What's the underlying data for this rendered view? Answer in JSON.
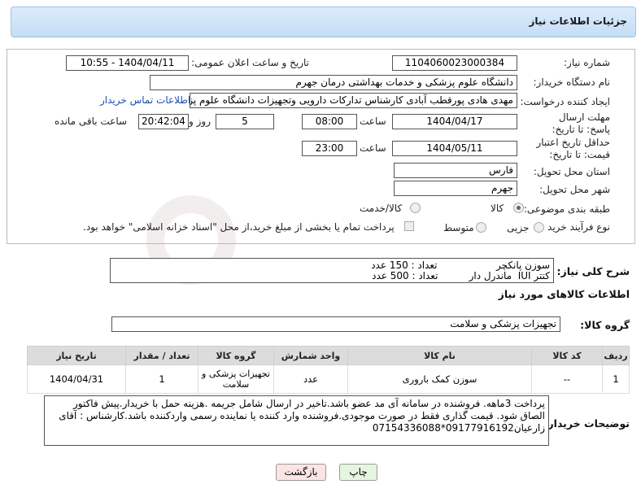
{
  "panel_title": "جزئیات اطلاعات نیاز",
  "need_number": {
    "label": "شماره نیاز:",
    "value": "1104060023000384"
  },
  "announce": {
    "label": "تاریخ و ساعت اعلان عمومی:",
    "value": "1404/04/11 - 10:55"
  },
  "buyer_org": {
    "label": "نام دستگاه خریدار:",
    "value": "دانشگاه علوم پزشکی و خدمات بهداشتی  درمان جهرم"
  },
  "requester": {
    "label": "ایجاد کننده درخواست:",
    "value": "مهدی هادی پورقطب آبادی کارشناس تدارکات دارویی وتجهیزات دانشگاه علوم پز",
    "contact_link": "اطلاعات تماس خریدار"
  },
  "reply_deadline": {
    "label": "مهلت ارسال پاسخ: تا تاریخ:",
    "date": "1404/04/17",
    "time_label": "ساعت",
    "time": "08:00",
    "days": "5",
    "days_label": "روز و",
    "remaining": "20:42:04",
    "remaining_label": "ساعت باقی مانده"
  },
  "price_validity": {
    "label": "حداقل تاریخ اعتبار قیمت: تا تاریخ:",
    "date": "1404/05/11",
    "time_label": "ساعت",
    "time": "23:00"
  },
  "province": {
    "label": "استان محل تحویل:",
    "value": "فارس"
  },
  "city": {
    "label": "شهر محل تحویل:",
    "value": "جهرم"
  },
  "category": {
    "label": "طبقه بندی موضوعی:",
    "options": [
      "کالا",
      "کالا/خدمت"
    ]
  },
  "purchase_type": {
    "label": "نوع فرآیند خرید :",
    "options": [
      "جزیی",
      "متوسط"
    ],
    "payment_text": "پرداخت تمام یا بخشی از مبلغ خرید،از محل \"اسناد خزانه اسلامی\" خواهد بود."
  },
  "description": {
    "label": "شرح کلی نیاز:",
    "line1": "سوزن پانکچر                   تعداد : 150 عدد",
    "line2": "کتتر IUI  ماندرل دار          تعداد : 500 عدد"
  },
  "goods_info_title": "اطلاعات کالاهای مورد نیاز",
  "goods_group": {
    "label": "گروه کالا:",
    "value": "تجهیزات پزشکی و سلامت"
  },
  "table": {
    "headers": [
      "ردیف",
      "کد کالا",
      "نام کالا",
      "واحد شمارش",
      "گروه کالا",
      "تعداد / مقدار",
      "تاریخ نیاز"
    ],
    "rows": [
      [
        "1",
        "--",
        "سوزن کمک باروری",
        "عدد",
        "تجهیزات پزشکی و سلامت",
        "1",
        "1404/04/31"
      ]
    ]
  },
  "buyer_notes": {
    "label": "توضیحات خریدار:",
    "text": "پرداخت 3ماهه. فروشنده در سامانه آی مد عضو باشد.تاخیر در ارسال شامل جریمه .هزینه حمل با خریدار.پیش فاکتور الصاق شود. قیمت گذاری فقط در صورت موجودی.فروشنده وارد کننده یا نماینده رسمی واردکننده باشد.کارشناس : آقای زارعیان09177916192*07154336088"
  },
  "buttons": {
    "print": "چاپ",
    "back": "بازگشت"
  },
  "colors": {
    "panel_bg": "#c5ddf6",
    "print_btn": "#e6f5e0",
    "back_btn": "#fce4e4",
    "link": "#1a4fb4"
  }
}
